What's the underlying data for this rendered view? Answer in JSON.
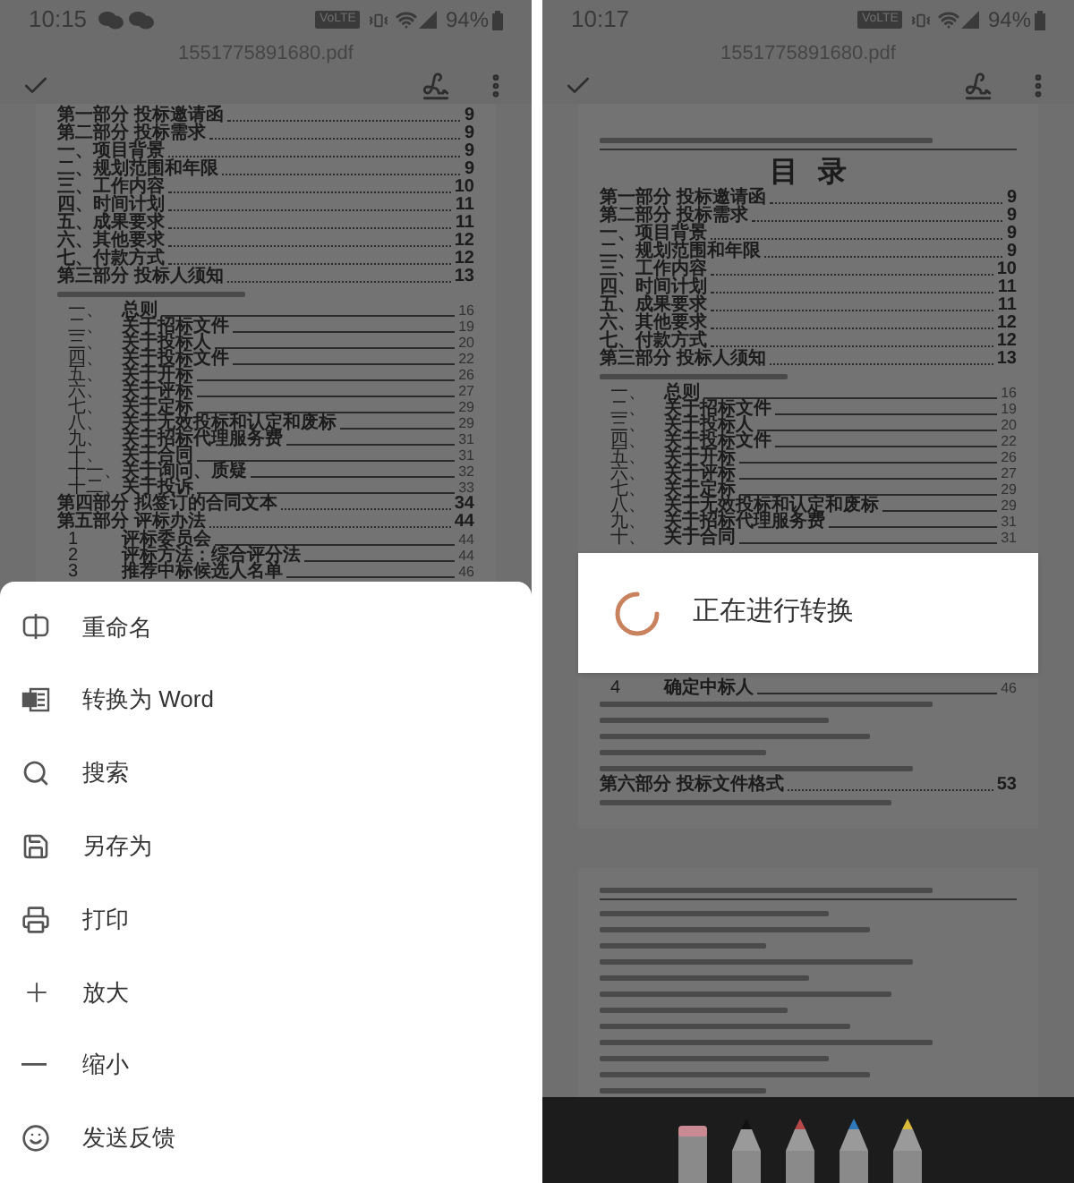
{
  "screens": [
    {
      "status_bar": {
        "time": "10:15",
        "notification_icons": [
          {
            "kind": "chat"
          },
          {
            "kind": "chat"
          }
        ],
        "network_badge": "VoLTE",
        "battery": "94%"
      },
      "title": "1551775891680.pdf",
      "document": {
        "entries": [
          {
            "kind": "main",
            "label": "第一部分  投标邀请函",
            "page": "9"
          },
          {
            "kind": "main",
            "label": "第二部分  投标需求",
            "page": "9"
          },
          {
            "kind": "main",
            "label": "一、项目背景",
            "page": "9"
          },
          {
            "kind": "main",
            "label": "二、规划范围和年限",
            "page": "9"
          },
          {
            "kind": "main",
            "label": "三、工作内容",
            "page": "10"
          },
          {
            "kind": "main",
            "label": "四、时间计划",
            "page": "11"
          },
          {
            "kind": "main",
            "label": "五、成果要求",
            "page": "11"
          },
          {
            "kind": "main",
            "label": "六、其他要求",
            "page": "12"
          },
          {
            "kind": "main",
            "label": "七、付款方式",
            "page": "12"
          },
          {
            "kind": "main",
            "label": "第三部分  投标人须知",
            "page": "13"
          },
          {
            "kind": "blurred"
          },
          {
            "kind": "sub",
            "number": "一、",
            "label": "总则",
            "page": "16"
          },
          {
            "kind": "sub",
            "number": "二、",
            "label": "关于招标文件",
            "page": "19"
          },
          {
            "kind": "sub",
            "number": "三、",
            "label": "关于投标人",
            "page": "20"
          },
          {
            "kind": "sub",
            "number": "四、",
            "label": "关于投标文件",
            "page": "22"
          },
          {
            "kind": "sub",
            "number": "五、",
            "label": "关于开标",
            "page": "26"
          },
          {
            "kind": "sub",
            "number": "六、",
            "label": "关于评标",
            "page": "27"
          },
          {
            "kind": "sub",
            "number": "七、",
            "label": "关于定标",
            "page": "29"
          },
          {
            "kind": "sub",
            "number": "八、",
            "label": "关于无效投标和认定和废标",
            "page": "29"
          },
          {
            "kind": "sub",
            "number": "九、",
            "label": "关于招标代理服务费",
            "page": "31"
          },
          {
            "kind": "sub",
            "number": "十、",
            "label": "关于合同",
            "page": "31"
          },
          {
            "kind": "sub",
            "number": "十一、",
            "label": "关于询问、质疑",
            "page": "32"
          },
          {
            "kind": "sub",
            "number": "十二、",
            "label": "关于投诉",
            "page": "33"
          },
          {
            "kind": "main",
            "label": "第四部分  拟签订的合同文本",
            "page": "34"
          },
          {
            "kind": "main",
            "label": "第五部分  评标办法",
            "page": "44"
          },
          {
            "kind": "sub",
            "number": "1",
            "label": "评标委员会",
            "page": "44"
          },
          {
            "kind": "sub",
            "number": "2",
            "label": "评标方法：综合评分法",
            "page": "44"
          },
          {
            "kind": "sub",
            "number": "3",
            "label": "推荐中标候选人名单",
            "page": "46"
          }
        ]
      },
      "menu": {
        "items": [
          {
            "label": "重命名"
          },
          {
            "label": "转换为 Word"
          },
          {
            "label": "搜索"
          },
          {
            "label": "另存为"
          },
          {
            "label": "打印"
          },
          {
            "label": "放大"
          },
          {
            "label": "缩小"
          },
          {
            "label": "发送反馈"
          }
        ]
      }
    },
    {
      "status_bar": {
        "time": "10:17",
        "network_badge": "VoLTE",
        "battery": "94%"
      },
      "title": "1551775891680.pdf",
      "document": {
        "header": {
          "kind": "blurred"
        },
        "heading": "目  录",
        "entries": [
          {
            "kind": "main",
            "label": "第一部分  投标邀请函",
            "page": "9"
          },
          {
            "kind": "main",
            "label": "第二部分  投标需求",
            "page": "9"
          },
          {
            "kind": "main",
            "label": "一、项目背景",
            "page": "9"
          },
          {
            "kind": "main",
            "label": "二、规划范围和年限",
            "page": "9"
          },
          {
            "kind": "main",
            "label": "三、工作内容",
            "page": "10"
          },
          {
            "kind": "main",
            "label": "四、时间计划",
            "page": "11"
          },
          {
            "kind": "main",
            "label": "五、成果要求",
            "page": "11"
          },
          {
            "kind": "main",
            "label": "六、其他要求",
            "page": "12"
          },
          {
            "kind": "main",
            "label": "七、付款方式",
            "page": "12"
          },
          {
            "kind": "main",
            "label": "第三部分  投标人须知",
            "page": "13"
          },
          {
            "kind": "blurred"
          },
          {
            "kind": "sub",
            "number": "一、",
            "label": "总则",
            "page": "16"
          },
          {
            "kind": "sub",
            "number": "二、",
            "label": "关于招标文件",
            "page": "19"
          },
          {
            "kind": "sub",
            "number": "三、",
            "label": "关于投标人",
            "page": "20"
          },
          {
            "kind": "sub",
            "number": "四、",
            "label": "关于投标文件",
            "page": "22"
          },
          {
            "kind": "sub",
            "number": "五、",
            "label": "关于开标",
            "page": "26"
          },
          {
            "kind": "sub",
            "number": "六、",
            "label": "关于评标",
            "page": "27"
          },
          {
            "kind": "sub",
            "number": "七、",
            "label": "关于定标",
            "page": "29"
          },
          {
            "kind": "sub",
            "number": "八、",
            "label": "关于无效投标和认定和废标",
            "page": "29"
          },
          {
            "kind": "sub",
            "number": "九、",
            "label": "关于招标代理服务费",
            "page": "31"
          },
          {
            "kind": "sub",
            "number": "十、",
            "label": "关于合同",
            "page": "31"
          }
        ],
        "entries_after_dialog": [
          {
            "kind": "sub",
            "number": "4",
            "label": "确定中标人",
            "page": "46"
          },
          {
            "kind": "blurred"
          },
          {
            "kind": "blurred"
          },
          {
            "kind": "blurred"
          },
          {
            "kind": "blurred"
          },
          {
            "kind": "blurred"
          },
          {
            "kind": "main",
            "label": "第六部分  投标文件格式",
            "page": "53"
          },
          {
            "kind": "blurred"
          }
        ],
        "next_page": {
          "entries": [
            {
              "kind": "blurred"
            },
            {
              "kind": "blurred"
            },
            {
              "kind": "blurred"
            },
            {
              "kind": "blurred"
            },
            {
              "kind": "blurred"
            },
            {
              "kind": "blurred"
            },
            {
              "kind": "blurred"
            },
            {
              "kind": "blurred"
            },
            {
              "kind": "blurred"
            },
            {
              "kind": "blurred"
            },
            {
              "kind": "blurred"
            },
            {
              "kind": "blurred"
            },
            {
              "kind": "blurred"
            }
          ]
        }
      },
      "dialog": {
        "message": "正在进行转换"
      },
      "pen_toolbar": {
        "pens": [
          {
            "kind": "eraser",
            "color": "#c98a94"
          },
          {
            "kind": "pen",
            "color": "#111111"
          },
          {
            "kind": "pen",
            "color": "#b8474a"
          },
          {
            "kind": "pen",
            "color": "#2f79b8"
          },
          {
            "kind": "pen",
            "color": "#d8b93a"
          }
        ]
      }
    }
  ]
}
